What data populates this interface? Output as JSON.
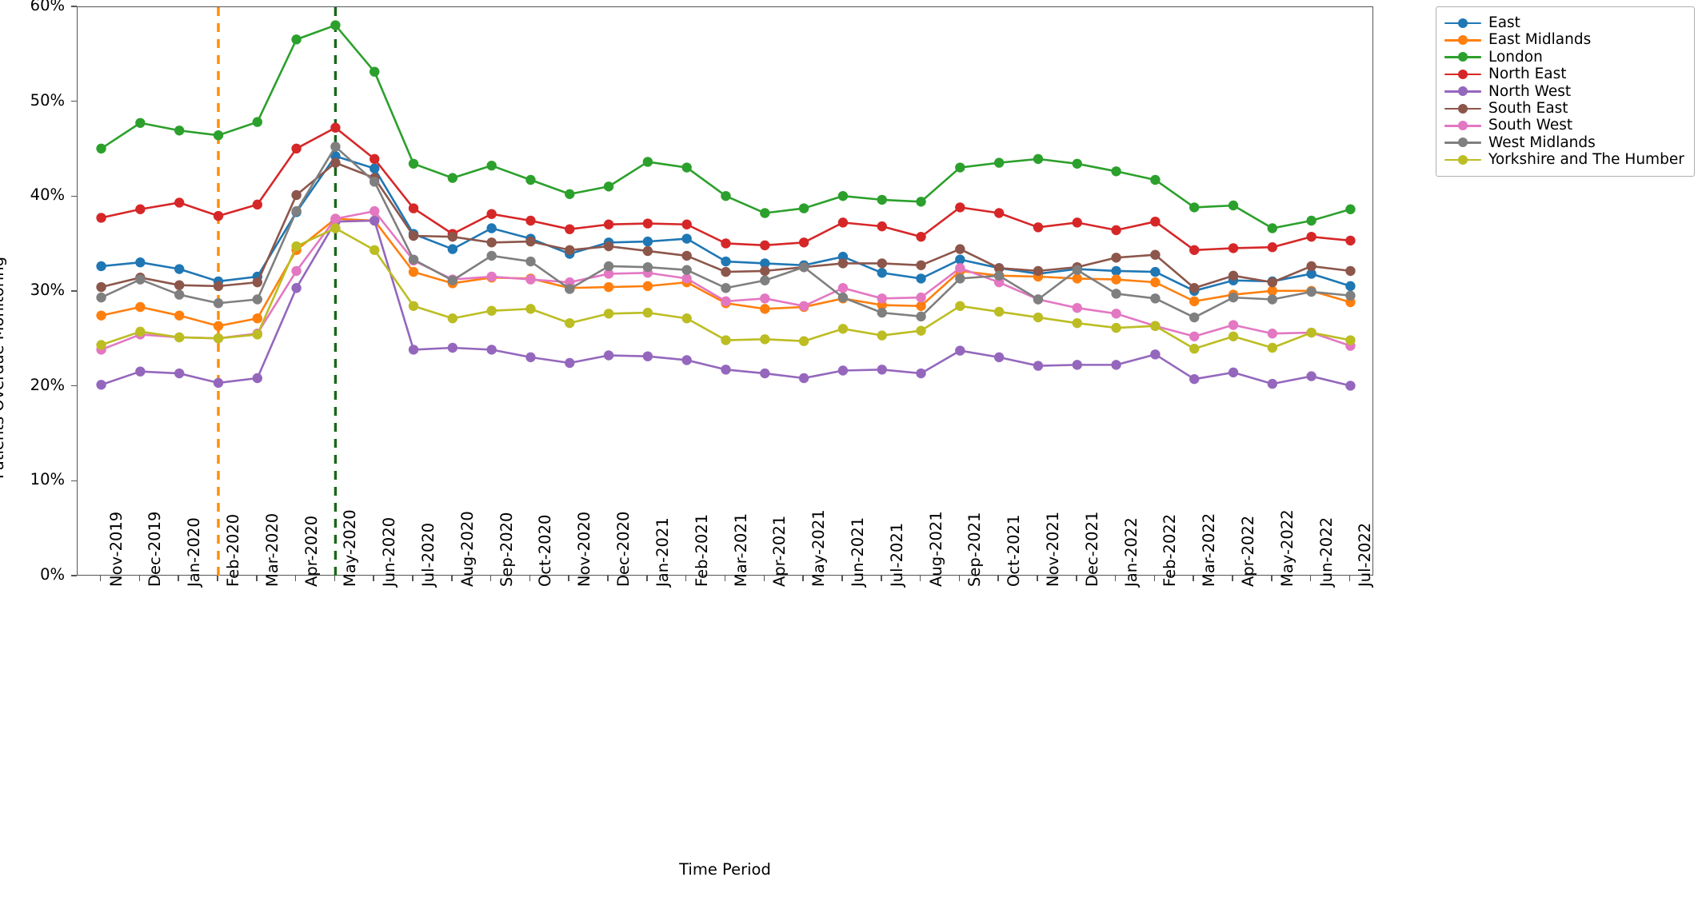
{
  "chart_data": {
    "type": "line",
    "title": "",
    "xlabel": "Time Period",
    "ylabel": "Patients Overdue Monitoring",
    "ylim": [
      0,
      60
    ],
    "ytick_labels": [
      "0%",
      "10%",
      "20%",
      "30%",
      "40%",
      "50%",
      "60%"
    ],
    "ytick_values": [
      0,
      10,
      20,
      30,
      40,
      50,
      60
    ],
    "grid": false,
    "legend_position": "upper right outside",
    "categories": [
      "Nov-2019",
      "Dec-2019",
      "Jan-2020",
      "Feb-2020",
      "Mar-2020",
      "Apr-2020",
      "May-2020",
      "Jun-2020",
      "Jul-2020",
      "Aug-2020",
      "Sep-2020",
      "Oct-2020",
      "Nov-2020",
      "Dec-2020",
      "Jan-2021",
      "Feb-2021",
      "Mar-2021",
      "Apr-2021",
      "May-2021",
      "Jun-2021",
      "Jul-2021",
      "Aug-2021",
      "Sep-2021",
      "Oct-2021",
      "Nov-2021",
      "Dec-2021",
      "Jan-2022",
      "Feb-2022",
      "Mar-2022",
      "Apr-2022",
      "May-2022",
      "Jun-2022",
      "Jul-2022"
    ],
    "series": [
      {
        "name": "East",
        "color": "#1f77b4",
        "values": [
          32.7,
          33.1,
          32.4,
          31.1,
          31.6,
          38.4,
          44.3,
          43.0,
          36.1,
          34.5,
          36.7,
          35.6,
          34.0,
          35.2,
          35.3,
          35.6,
          33.2,
          33.0,
          32.8,
          33.7,
          32.0,
          31.4,
          33.4,
          32.5,
          31.9,
          32.4,
          32.2,
          32.1,
          30.1,
          31.2,
          31.1,
          31.9,
          30.6
        ]
      },
      {
        "name": "East Midlands",
        "color": "#ff7f0e",
        "values": [
          27.5,
          28.4,
          27.5,
          26.4,
          27.2,
          34.4,
          37.7,
          37.5,
          32.1,
          30.9,
          31.5,
          31.4,
          30.4,
          30.5,
          30.6,
          31.0,
          28.8,
          28.2,
          28.4,
          29.3,
          28.6,
          28.5,
          32.2,
          31.7,
          31.6,
          31.4,
          31.3,
          31.0,
          29.0,
          29.7,
          30.1,
          30.1,
          28.9
        ]
      },
      {
        "name": "London",
        "color": "#2ca02c",
        "values": [
          45.1,
          47.8,
          47.0,
          46.5,
          47.9,
          56.6,
          58.1,
          53.2,
          43.5,
          42.0,
          43.3,
          41.8,
          40.3,
          41.1,
          43.7,
          43.1,
          40.1,
          38.3,
          38.8,
          40.1,
          39.7,
          39.5,
          43.1,
          43.6,
          44.0,
          43.5,
          42.7,
          41.8,
          38.9,
          39.1,
          36.7,
          37.5,
          38.7
        ]
      },
      {
        "name": "North East",
        "color": "#d62728",
        "values": [
          37.8,
          38.7,
          39.4,
          38.0,
          39.2,
          45.1,
          47.3,
          44.0,
          38.8,
          36.1,
          38.2,
          37.5,
          36.6,
          37.1,
          37.2,
          37.1,
          35.1,
          34.9,
          35.2,
          37.3,
          36.9,
          35.8,
          38.9,
          38.3,
          36.8,
          37.3,
          36.5,
          37.4,
          34.4,
          34.6,
          34.7,
          35.8,
          35.4
        ]
      },
      {
        "name": "North West",
        "color": "#9467bd",
        "values": [
          20.2,
          21.6,
          21.4,
          20.4,
          20.9,
          30.4,
          37.4,
          37.5,
          23.9,
          24.1,
          23.9,
          23.1,
          22.5,
          23.3,
          23.2,
          22.8,
          21.8,
          21.4,
          20.9,
          21.7,
          21.8,
          21.4,
          23.8,
          23.1,
          22.2,
          22.3,
          22.3,
          23.4,
          20.8,
          21.5,
          20.3,
          21.1,
          20.1
        ]
      },
      {
        "name": "South East",
        "color": "#8c564b",
        "values": [
          30.5,
          31.5,
          30.7,
          30.6,
          31.0,
          40.2,
          43.6,
          42.0,
          35.9,
          35.8,
          35.2,
          35.3,
          34.4,
          34.8,
          34.3,
          33.8,
          32.1,
          32.2,
          32.6,
          33.0,
          33.0,
          32.8,
          34.5,
          32.5,
          32.2,
          32.6,
          33.6,
          33.9,
          30.4,
          31.7,
          31.0,
          32.7,
          32.2
        ]
      },
      {
        "name": "South West",
        "color": "#e377c2",
        "values": [
          23.9,
          25.5,
          25.2,
          25.1,
          25.6,
          32.2,
          37.7,
          38.5,
          33.3,
          31.3,
          31.6,
          31.3,
          31.0,
          31.9,
          32.0,
          31.4,
          29.0,
          29.3,
          28.5,
          30.4,
          29.3,
          29.4,
          32.5,
          31.0,
          29.2,
          28.3,
          27.7,
          26.4,
          25.3,
          26.5,
          25.6,
          25.7,
          24.3
        ]
      },
      {
        "name": "West Midlands",
        "color": "#7f7f7f",
        "values": [
          29.4,
          31.3,
          29.7,
          28.8,
          29.2,
          38.5,
          45.3,
          41.6,
          33.4,
          31.2,
          33.8,
          33.2,
          30.3,
          32.7,
          32.6,
          32.3,
          30.4,
          31.2,
          32.6,
          29.4,
          27.8,
          27.4,
          31.4,
          31.7,
          29.2,
          32.3,
          29.8,
          29.3,
          27.3,
          29.4,
          29.2,
          30.0,
          29.6
        ]
      },
      {
        "name": "Yorkshire and The Humber",
        "color": "#bcbd22",
        "values": [
          24.4,
          25.8,
          25.2,
          25.1,
          25.5,
          34.8,
          36.7,
          34.4,
          28.5,
          27.2,
          28.0,
          28.2,
          26.7,
          27.7,
          27.8,
          27.2,
          24.9,
          25.0,
          24.8,
          26.1,
          25.4,
          25.9,
          28.5,
          27.9,
          27.3,
          26.7,
          26.2,
          26.4,
          24.0,
          25.3,
          24.1,
          25.7,
          24.9
        ]
      }
    ],
    "annotations": [
      {
        "name": "vline-feb-2020",
        "type": "vertical-dashed-line",
        "x": "Feb-2020",
        "color": "#ff8c00"
      },
      {
        "name": "vline-may-2020",
        "type": "vertical-dashed-line",
        "x": "May-2020",
        "color": "#1a661a"
      }
    ]
  }
}
